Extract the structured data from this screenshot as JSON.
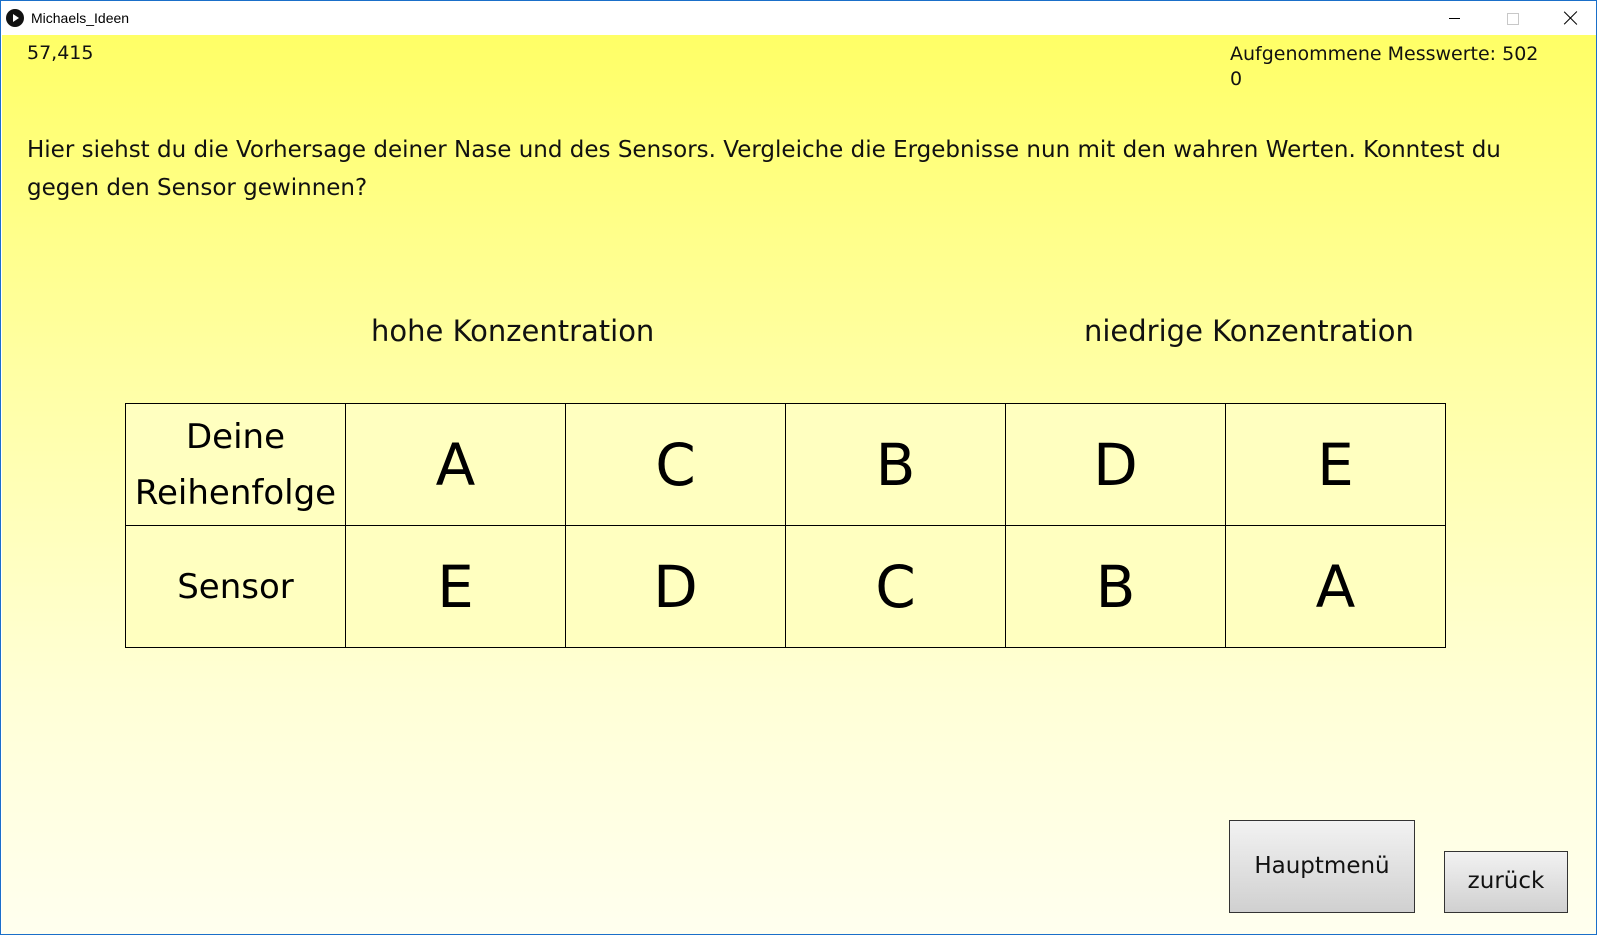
{
  "window": {
    "title": "Michaels_Ideen",
    "minimize": "minimize",
    "maximize": "maximize",
    "close": "close"
  },
  "status": {
    "value_left": "57,415",
    "measurements_label": "Aufgenommene Messwerte: 502",
    "measurements_extra": "0"
  },
  "instruction": "Hier siehst du die Vorhersage deiner Nase und des Sensors. Vergleiche die Ergebnisse nun mit den wahren Werten. Konntest du gegen den Sensor gewinnen?",
  "headings": {
    "high": "hohe Konzentration",
    "low": "niedrige Konzentration"
  },
  "table": {
    "rows": [
      {
        "label_line1": "Deine",
        "label_line2": "Reihenfolge",
        "cells": [
          "A",
          "C",
          "B",
          "D",
          "E"
        ]
      },
      {
        "label": "Sensor",
        "cells": [
          "E",
          "D",
          "C",
          "B",
          "A"
        ]
      }
    ]
  },
  "buttons": {
    "main_menu": "Hauptmenü",
    "back": "zurück"
  },
  "colors": {
    "background_top": "#ffff66",
    "background_bottom": "#ffffef",
    "table_fill": "#ffffc0",
    "window_border": "#1a6fc9"
  }
}
